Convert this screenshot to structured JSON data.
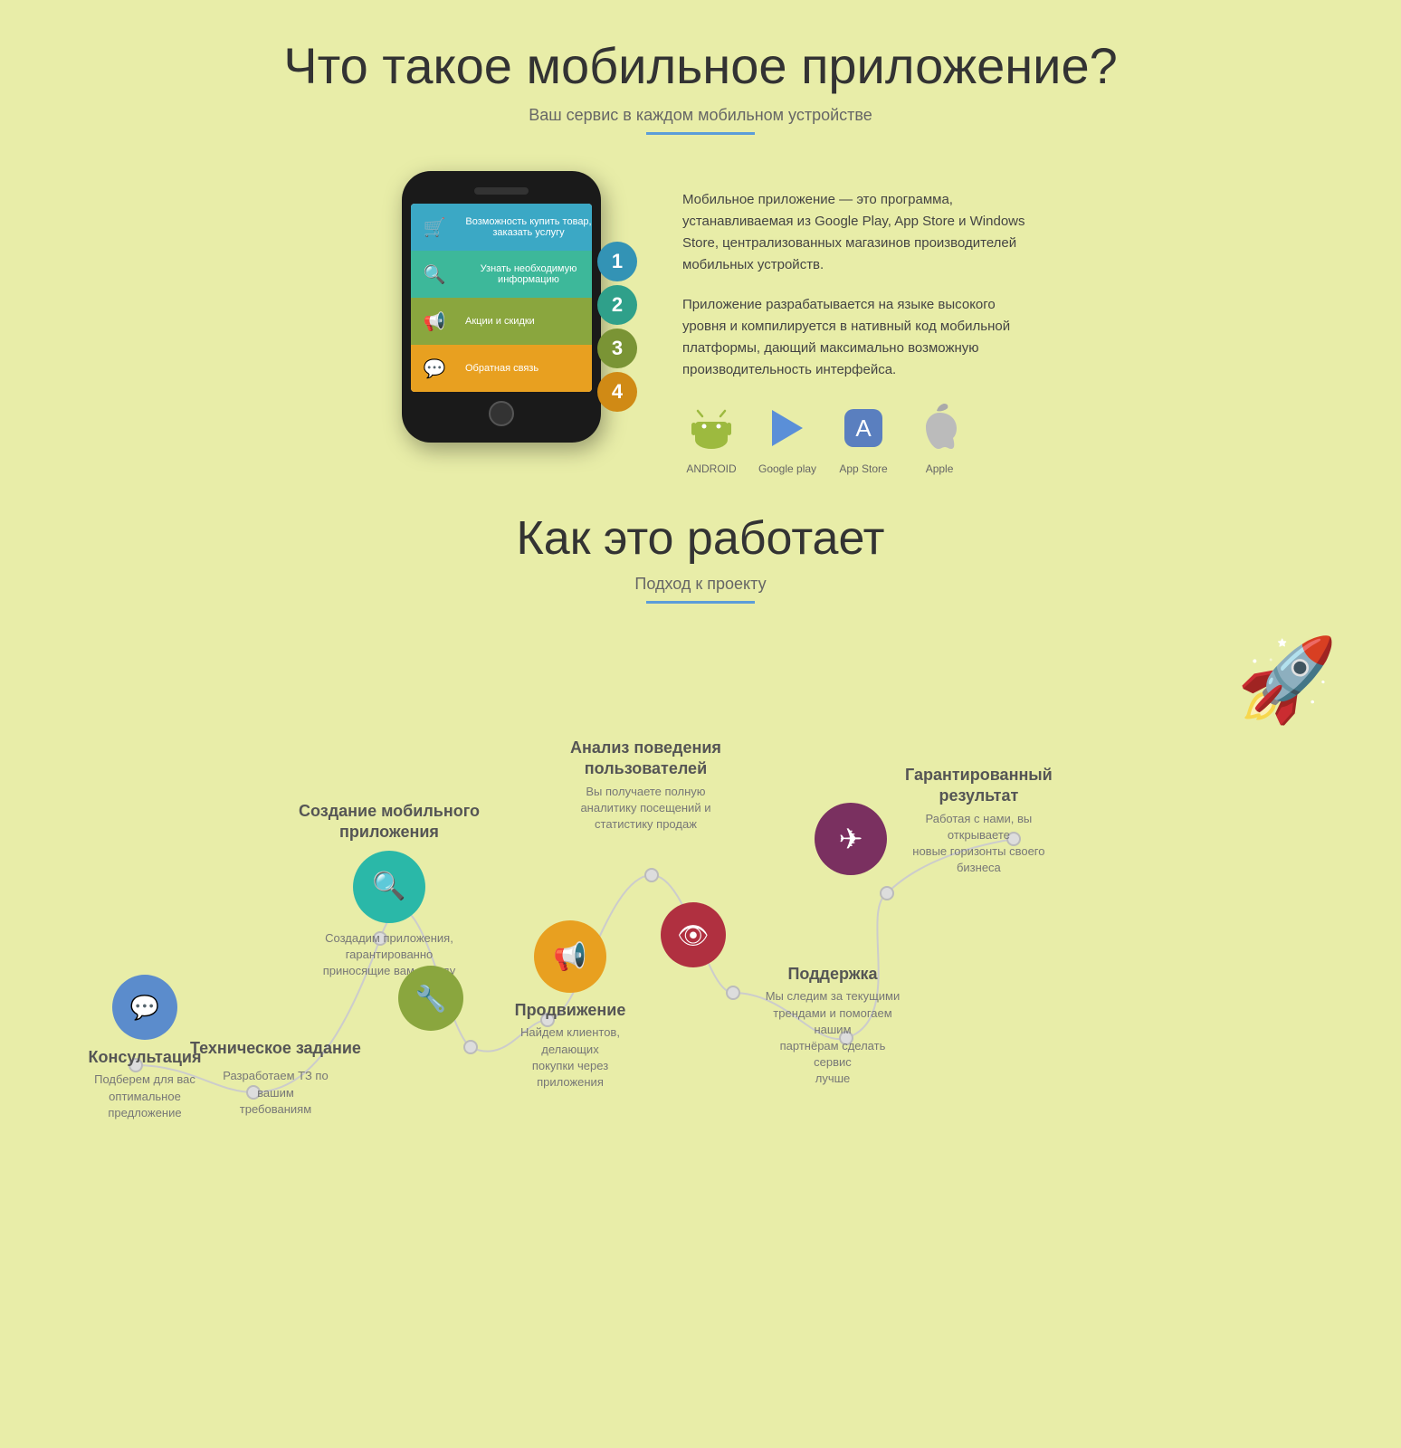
{
  "section1": {
    "title": "Что такое мобильное приложение?",
    "subtitle": "Ваш сервис в каждом мобильном устройстве",
    "phone_rows": [
      {
        "icon": "🛒",
        "label": "Возможность купить товар, заказать услугу",
        "num": "1",
        "color_class": "row-blue"
      },
      {
        "icon": "🔍",
        "label": "Узнать необходимую информацию",
        "num": "2",
        "color_class": "row-teal"
      },
      {
        "icon": "📢",
        "label": "Акции и скидки",
        "num": "3",
        "color_class": "row-olive"
      },
      {
        "icon": "💬",
        "label": "Обратная связь",
        "num": "4",
        "color_class": "row-orange"
      }
    ],
    "desc1": "Мобильное приложение — это программа, устанавливаемая из Google Play, App Store и Windows Store, централизованных магазинов производителей мобильных устройств.",
    "desc2": "Приложение разрабатывается на языке высокого уровня и компилируется в нативный код мобильной платформы, дающий максимально возможную производительность интерфейса.",
    "stores": [
      {
        "label": "ANDROID",
        "icon": "🤖"
      },
      {
        "label": "Google play",
        "icon": "▶"
      },
      {
        "label": "App Store",
        "icon": "🅰"
      },
      {
        "label": "Apple",
        "icon": ""
      }
    ]
  },
  "section2": {
    "title": "Как это работает",
    "subtitle": "Подход к проекту",
    "nodes": [
      {
        "id": "konsultacia",
        "title": "Консультация",
        "desc": "Подберем для вас оптимальное предложение",
        "icon": "💬",
        "color": "#5b8ccc"
      },
      {
        "id": "tz",
        "title": "Техническое задание",
        "desc": "Разработаем ТЗ по вашим требованиям",
        "icon": "💬",
        "color": "#5b8ccc"
      },
      {
        "id": "sozdanie",
        "title": "Создание мобильного приложения",
        "desc": "Создадим приложения, гарантированно приносящие вам выгоду",
        "icon": "🔍",
        "color": "#2ab8a8"
      },
      {
        "id": "wrench",
        "title": "",
        "desc": "",
        "icon": "🔧",
        "color": "#8aa63e"
      },
      {
        "id": "prodvizhenie",
        "title": "Продвижение",
        "desc": "Найдем клиентов, делающих покупки через приложения",
        "icon": "📢",
        "color": "#e8a020"
      },
      {
        "id": "analiz",
        "title": "Анализ поведения пользователей",
        "desc": "Вы получаете полную аналитику посещений и статистику продаж",
        "icon": "📢",
        "color": "#e8a020"
      },
      {
        "id": "eye",
        "title": "",
        "desc": "",
        "icon": "👁",
        "color": "#b03040"
      },
      {
        "id": "podderzhka",
        "title": "Поддержка",
        "desc": "Мы следим за текущими трендами и помогаем нашим партнёрам сделать сервис лучше",
        "icon": "",
        "color": ""
      },
      {
        "id": "plane",
        "title": "",
        "desc": "",
        "icon": "✈",
        "color": "#7a3060"
      },
      {
        "id": "garantia",
        "title": "Гарантированный результат",
        "desc": "Работая с нами, вы открываете новые горизонты своего бизнеса",
        "icon": "",
        "color": ""
      }
    ]
  }
}
